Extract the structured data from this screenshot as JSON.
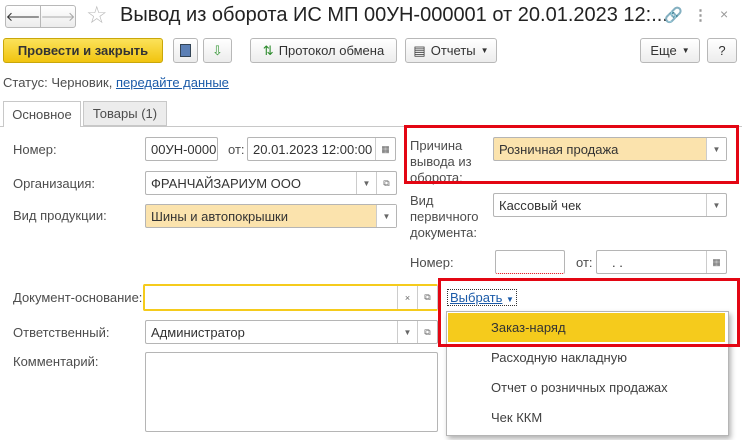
{
  "window": {
    "title": "Вывод из оборота ИС МП 00УН-000001 от 20.01.2023 12:..."
  },
  "toolbar": {
    "post_close": "Провести и закрыть",
    "exchange_log": "Протокол обмена",
    "reports": "Отчеты",
    "more": "Еще",
    "help": "?"
  },
  "status": {
    "label": "Статус:",
    "value": "Черновик,",
    "link": "передайте данные"
  },
  "tabs": [
    {
      "label": "Основное"
    },
    {
      "label": "Товары (1)"
    }
  ],
  "form": {
    "number_label": "Номер:",
    "number": "00УН-0000",
    "from_label": "от:",
    "date": "20.01.2023 12:00:00",
    "org_label": "Организация:",
    "org": "ФРАНЧАЙЗАРИУМ ООО",
    "product_label": "Вид продукции:",
    "product": "Шины и автопокрышки",
    "reason_label": "Причина вывода из оборота:",
    "reason": "Розничная продажа",
    "primary_doc_label": "Вид первичного документа:",
    "primary_doc": "Кассовый чек",
    "doc_number_label": "Номер:",
    "doc_number": "",
    "doc_from_label": "от:",
    "doc_date": " .  .",
    "base_doc_label": "Документ-основание:",
    "base_doc": "",
    "select_link": "Выбрать",
    "responsible_label": "Ответственный:",
    "responsible": "Администратор",
    "comment_label": "Комментарий:",
    "comment": ""
  },
  "menu": {
    "items": [
      "Заказ-наряд",
      "Расходную накладную",
      "Отчет о розничных продажах",
      "Чек ККМ"
    ]
  },
  "colors": {
    "accent": "#f5cb1c",
    "highlight": "#e30613",
    "link": "#1a5aa8"
  }
}
